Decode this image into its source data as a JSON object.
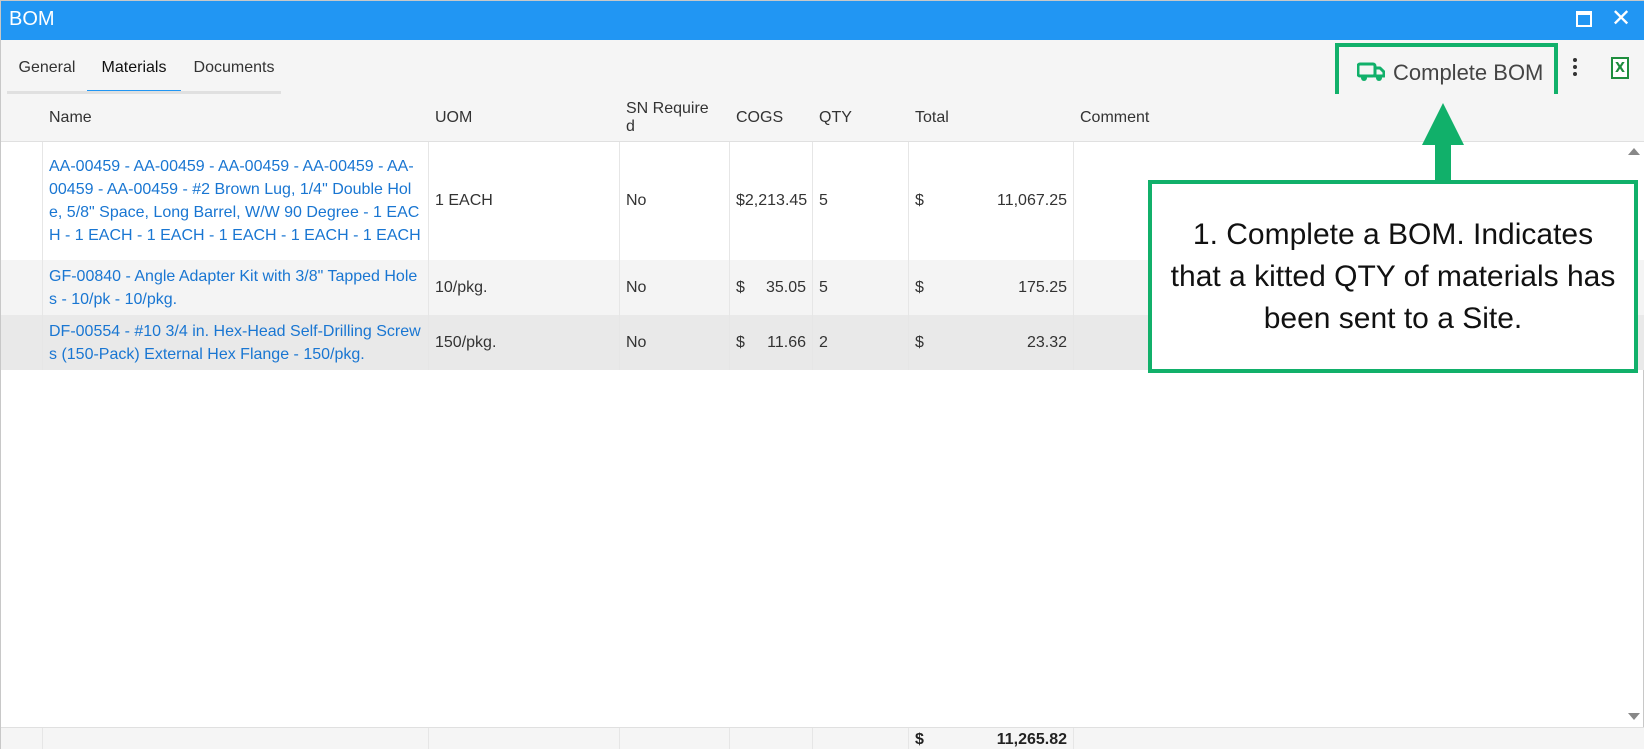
{
  "window": {
    "title": "BOM"
  },
  "tabs": [
    {
      "label": "General"
    },
    {
      "label": "Materials"
    },
    {
      "label": "Documents"
    }
  ],
  "toolbar": {
    "complete_label": "Complete BOM"
  },
  "grid": {
    "columns": [
      "Name",
      "UOM",
      "SN Required",
      "COGS",
      "QTY",
      "Total",
      "Comment"
    ],
    "rows": [
      {
        "name": "AA-00459 - AA-00459 - AA-00459 - AA-00459 - AA-00459 - AA-00459 - #2 Brown Lug, 1/4\" Double Hole, 5/8\" Space, Long Barrel, W/W 90 Degree - 1 EACH - 1 EACH - 1 EACH - 1 EACH - 1 EACH - 1 EACH",
        "uom": "1 EACH",
        "sn_required": "No",
        "cogs_symbol": "",
        "cogs": "$2,213.45",
        "qty": "5",
        "total_symbol": "$",
        "total": "11,067.25",
        "comment": ""
      },
      {
        "name": "GF-00840 - Angle Adapter Kit with 3/8\" Tapped Holes - 10/pk - 10/pkg.",
        "uom": "10/pkg.",
        "sn_required": "No",
        "cogs_symbol": "$",
        "cogs": "35.05",
        "qty": "5",
        "total_symbol": "$",
        "total": "175.25",
        "comment": ""
      },
      {
        "name": "DF-00554 - #10 3/4 in. Hex-Head Self-Drilling Screws (150-Pack) External Hex Flange - 150/pkg.",
        "uom": "150/pkg.",
        "sn_required": "No",
        "cogs_symbol": "$",
        "cogs": "11.66",
        "qty": "2",
        "total_symbol": "$",
        "total": "23.32",
        "comment": ""
      }
    ],
    "footer": {
      "total_symbol": "$",
      "total": "11,265.82"
    }
  },
  "callout": {
    "text": "1. Complete a BOM. Indicates that a kitted QTY of materials has been sent to a Site."
  },
  "colors": {
    "titlebar": "#2196f3",
    "accent_green": "#11b06a",
    "link": "#1976d2"
  },
  "icons": [
    "maximize-icon",
    "close-icon",
    "truck-icon",
    "more-vertical-icon",
    "excel-export-icon"
  ]
}
